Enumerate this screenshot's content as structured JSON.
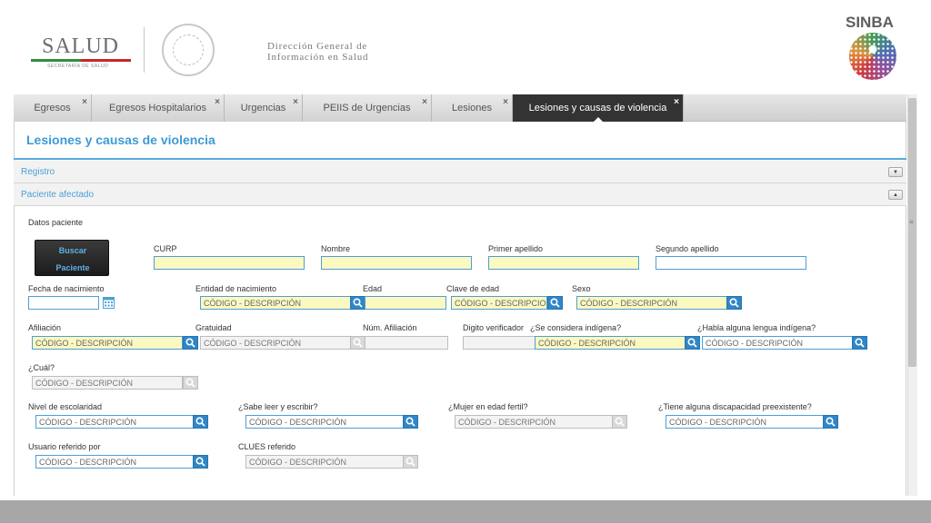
{
  "header": {
    "salud_logo": "SALUD",
    "salud_sub": "SECRETARÍA DE SALUD",
    "dg_line1": "Dirección General de",
    "dg_line2": "Información en Salud",
    "sinba": "SINBA"
  },
  "tabs": [
    {
      "label": "Egresos",
      "close": "×"
    },
    {
      "label": "Egresos Hospitalarios",
      "close": "×"
    },
    {
      "label": "Urgencias",
      "close": "×"
    },
    {
      "label": "PEIIS de Urgencias",
      "close": "×"
    },
    {
      "label": "Lesiones",
      "close": "×"
    },
    {
      "label": "Lesiones y causas de violencia",
      "close": "×",
      "active": true
    }
  ],
  "page_title": "Lesiones y causas de violencia",
  "sections": {
    "registro": "Registro",
    "paciente": "Paciente afectado"
  },
  "form": {
    "datos_paciente": "Datos paciente",
    "buscar": "Buscar",
    "paciente": "Paciente",
    "curp": "CURP",
    "nombre": "Nombre",
    "primer_apellido": "Primer apellido",
    "segundo_apellido": "Segundo apellido",
    "fecha_nacimiento": "Fecha de nacimiento",
    "entidad_nacimiento": "Entidad de nacimiento",
    "edad": "Edad",
    "clave_edad": "Clave de edad",
    "sexo": "Sexo",
    "afiliacion": "Afiliación",
    "gratuidad": "Gratuidad",
    "num_afiliacion": "Núm. Afiliación",
    "digito_verificador": "Digito verificador",
    "indigena": "¿Se considera indígena?",
    "lengua_indigena": "¿Habla alguna lengua indígena?",
    "cual": "¿Cuál?",
    "escolaridad": "Nivel de escolaridad",
    "leer_escribir": "¿Sabe leer y escribir?",
    "mujer_fertil": "¿Mujer en edad fertil?",
    "discapacidad": "¿Tiene alguna discapacidad preexistente?",
    "usuario_referido": "Usuario referido por",
    "clues_referido": "CLUES referido",
    "placeholder": "CÓDIGO - DESCRIPCIÓN",
    "placeholder_cut": "CÓDIGO - DESCRIPCION"
  },
  "colors": {
    "accent": "#3d9ad6",
    "required_bg": "#fbf8c0",
    "search_btn": "#2f86c8",
    "active_tab": "#333333"
  }
}
